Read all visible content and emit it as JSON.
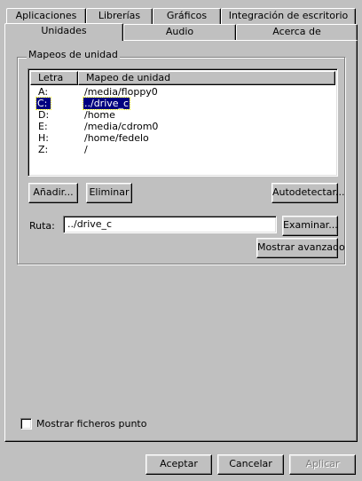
{
  "tabs_back": [
    {
      "label": "Aplicaciones"
    },
    {
      "label": "Librerías"
    },
    {
      "label": "Gráficos"
    },
    {
      "label": "Integración de escritorio"
    }
  ],
  "tabs_front": [
    {
      "label": "Unidades",
      "active": true
    },
    {
      "label": "Audio"
    },
    {
      "label": "Acerca de"
    }
  ],
  "group": {
    "title": "Mapeos de unidad",
    "columns": {
      "letter": "Letra",
      "mapping": "Mapeo de unidad"
    },
    "rows": [
      {
        "letter": "A:",
        "mapping": "/media/floppy0"
      },
      {
        "letter": "C:",
        "mapping": "../drive_c",
        "selected": true
      },
      {
        "letter": "D:",
        "mapping": "/home"
      },
      {
        "letter": "E:",
        "mapping": "/media/cdrom0"
      },
      {
        "letter": "H:",
        "mapping": "/home/fedelo"
      },
      {
        "letter": "Z:",
        "mapping": "/"
      }
    ],
    "add_label": "Añadir...",
    "remove_label": "Eliminar",
    "autodetect_label": "Autodetectar..."
  },
  "path": {
    "label": "Ruta:",
    "value": "../drive_c",
    "browse_label": "Examinar...",
    "advanced_label": "Mostrar avanzado"
  },
  "show_dotfiles": {
    "label": "Mostrar ficheros punto",
    "checked": false
  },
  "footer": {
    "accept_label": "Aceptar",
    "cancel_label": "Cancelar",
    "apply_label": "Aplicar"
  },
  "colors": {
    "face": "#c0c0c0",
    "selection": "#000080",
    "window": "#ffffff"
  }
}
